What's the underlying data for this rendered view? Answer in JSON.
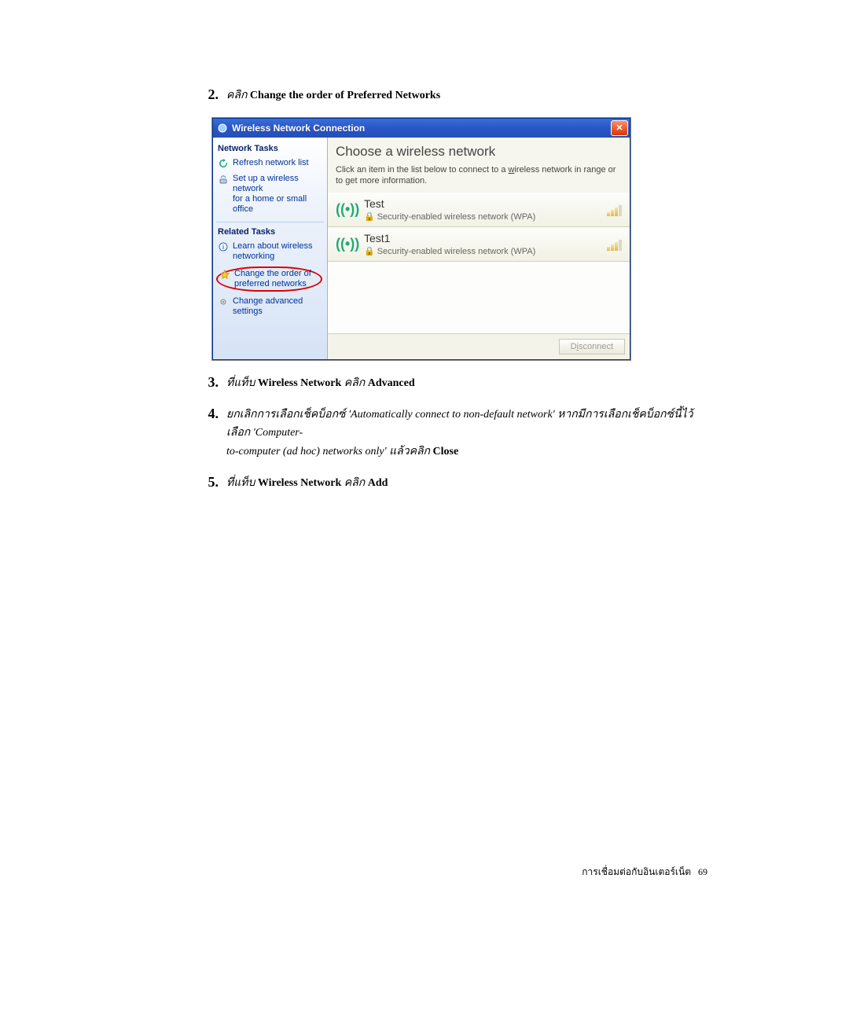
{
  "steps": {
    "s2": {
      "num": "2.",
      "t_prefix_thai": "คลิก ",
      "t_bold": "Change the order of Preferred Networks"
    },
    "s3": {
      "num": "3.",
      "t1_thai": "ที่แท็บ ",
      "t2_bold": "Wireless Network",
      "t3_thai": " คลิก ",
      "t4_bold": "Advanced"
    },
    "s4": {
      "num": "4.",
      "l1_thai": "ยกเลิกการเลือกเช็คบ็อกซ์ ",
      "l1_q1": "'Automatically connect to non-default network'",
      "l1_thai2": " หากมีการเลือกเช็คบ็อกซ์นี้ไว้ เลือก ",
      "l1_q2": "'Computer-",
      "l2_q2b": "to-computer (ad hoc) networks only'",
      "l2_thai": " แล้วคลิก ",
      "l2_bold": "Close"
    },
    "s5": {
      "num": "5.",
      "t1_thai": "ที่แท็บ ",
      "t2_bold": "Wireless Network",
      "t3_thai": " คลิก ",
      "t4_bold": "Add"
    }
  },
  "xpwin": {
    "title": "Wireless Network Connection",
    "close_glyph": "✕",
    "sidebar": {
      "heading1": "Network Tasks",
      "task_refresh": "Refresh network list",
      "task_setup_l1": "Set up a wireless network",
      "task_setup_l2": "for a home or small office",
      "heading2": "Related Tasks",
      "task_learn_l1": "Learn about wireless",
      "task_learn_l2": "networking",
      "task_order_l1": "Change the order of",
      "task_order_l2": "preferred networks",
      "task_adv_l1": "Change advanced",
      "task_adv_l2": "settings"
    },
    "main": {
      "heading": "Choose a wireless network",
      "sub_pre": "Click an item in the list below to connect to a ",
      "sub_u": "w",
      "sub_post": "ireless network in range or to get more information.",
      "antenna_glyph": "((•))",
      "lock_glyph": "🔒",
      "networks": [
        {
          "name": "Test",
          "sec": "Security-enabled wireless network (WPA)",
          "bars": 3
        },
        {
          "name": "Test1",
          "sec": "Security-enabled wireless network (WPA)",
          "bars": 3
        }
      ],
      "btn_pre": "D",
      "btn_u": "i",
      "btn_post": "sconnect"
    }
  },
  "footer": {
    "label_thai": "การเชื่อมต่อกับอินเตอร์เน็ต",
    "page": "69"
  }
}
